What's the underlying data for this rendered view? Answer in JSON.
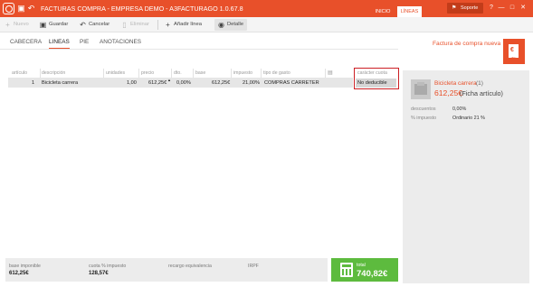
{
  "window": {
    "title": "FACTURAS COMPRA - EMPRESA DEMO - A3FACTURAGO 1.0.67.8",
    "tabs": [
      "INICIO",
      "LÍNEAS"
    ],
    "active_tab": "LÍNEAS",
    "support_label": "Soporte",
    "controls": [
      "help",
      "minimize",
      "maximize",
      "close"
    ],
    "accent": "#e8502a"
  },
  "toolbar": {
    "new_label": "Nuevo",
    "save_label": "Guardar",
    "cancel_label": "Cancelar",
    "delete_label": "Eliminar",
    "add_line_label": "Añadir línea",
    "detail_label": "Detalle"
  },
  "tabs": [
    "CABECERA",
    "LINEAS",
    "PIE",
    "ANOTACIONES"
  ],
  "active_tab": "LINEAS",
  "document_title": "Factura de compra nueva",
  "grid": {
    "columns": [
      "artículo",
      "descripción",
      "unidades",
      "precio",
      "dto.",
      "base",
      "impuesto",
      "tipo de gasto",
      "carácter cuota"
    ],
    "rows": [
      {
        "articulo": "1",
        "descripcion": "Bicicleta carrera",
        "unidades": "1,00",
        "precio": "612,25€",
        "dto": "0,00%",
        "base": "612,25€",
        "impuesto": "21,00%",
        "tipo_gasto": "COMPRAS CARRETER",
        "caracter_cuota": "No deducible"
      }
    ],
    "highlight_color": "#cc1f24"
  },
  "side_panel": {
    "product_name": "Bicicleta carrera",
    "product_qty": "(1)",
    "product_price": "612,25€",
    "product_link": "(Ficha artículo)",
    "props": [
      {
        "label": "descuentos",
        "value": "0,00%"
      },
      {
        "label": "% impuesto",
        "value": "Ordinario 21 %"
      }
    ]
  },
  "totals": {
    "base_imponible_label": "base imponible",
    "base_imponible": "612,25€",
    "cuota_label": "cuota % impuesto",
    "cuota": "128,57€",
    "recargo_label": "recargo equivalencia",
    "recargo": "",
    "irpf_label": "IRPF",
    "irpf": "",
    "total_label": "total",
    "total": "740,82€",
    "total_color": "#5dbb3e"
  }
}
